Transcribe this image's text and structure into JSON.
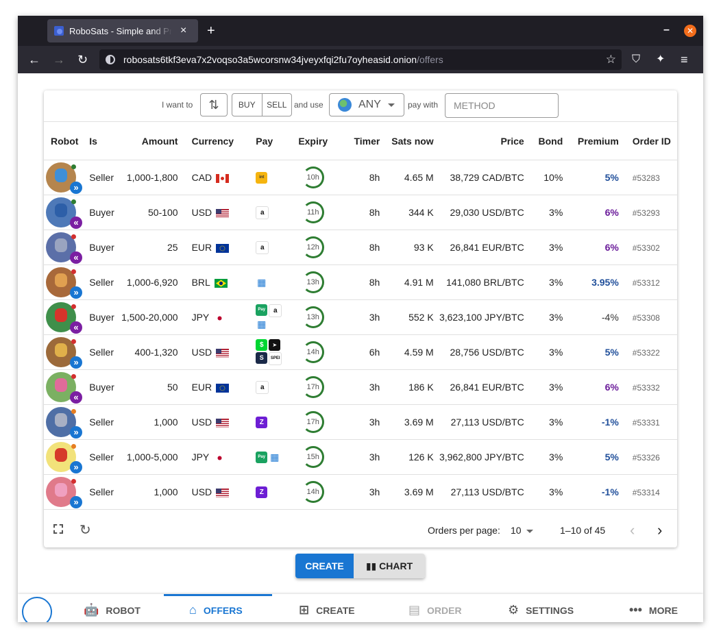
{
  "browser": {
    "tab_title": "RoboSats - Simple and Private",
    "tab_close": "×",
    "new_tab": "+",
    "url_host": "robosats6tkf3eva7x2voqso3a5wcorsnw34jveyxfqi2fu7oyheasid.onion",
    "url_path": "/offers"
  },
  "filters": {
    "i_want_to": "I want to",
    "buy": "BUY",
    "sell": "SELL",
    "and_use": "and use",
    "currency": "ANY",
    "pay_with": "pay with",
    "method_placeholder": "METHOD"
  },
  "table": {
    "headers": [
      "Robot",
      "Is",
      "Amount",
      "Currency",
      "Pay",
      "Expiry",
      "Timer",
      "Sats now",
      "Price",
      "Bond",
      "Premium",
      "Order ID"
    ],
    "rows": [
      {
        "is": "Seller",
        "amount": "1,000-1,800",
        "currency": "CAD",
        "expiry": "10h",
        "timer": "8h",
        "sats": "4.65 M",
        "price": "38,729 CAD/BTC",
        "bond": "10%",
        "premium": "5%",
        "order_id": "#53283"
      },
      {
        "is": "Buyer",
        "amount": "50-100",
        "currency": "USD",
        "expiry": "11h",
        "timer": "8h",
        "sats": "344 K",
        "price": "29,030 USD/BTC",
        "bond": "3%",
        "premium": "6%",
        "order_id": "#53293"
      },
      {
        "is": "Buyer",
        "amount": "25",
        "currency": "EUR",
        "expiry": "12h",
        "timer": "8h",
        "sats": "93 K",
        "price": "26,841 EUR/BTC",
        "bond": "3%",
        "premium": "6%",
        "order_id": "#53302"
      },
      {
        "is": "Seller",
        "amount": "1,000-6,920",
        "currency": "BRL",
        "expiry": "13h",
        "timer": "8h",
        "sats": "4.91 M",
        "price": "141,080 BRL/BTC",
        "bond": "3%",
        "premium": "3.95%",
        "order_id": "#53312"
      },
      {
        "is": "Buyer",
        "amount": "1,500-20,000",
        "currency": "JPY",
        "expiry": "13h",
        "timer": "3h",
        "sats": "552 K",
        "price": "3,623,100 JPY/BTC",
        "bond": "3%",
        "premium": "-4%",
        "order_id": "#53308"
      },
      {
        "is": "Seller",
        "amount": "400-1,320",
        "currency": "USD",
        "expiry": "14h",
        "timer": "6h",
        "sats": "4.59 M",
        "price": "28,756 USD/BTC",
        "bond": "3%",
        "premium": "5%",
        "order_id": "#53322"
      },
      {
        "is": "Buyer",
        "amount": "50",
        "currency": "EUR",
        "expiry": "17h",
        "timer": "3h",
        "sats": "186 K",
        "price": "26,841 EUR/BTC",
        "bond": "3%",
        "premium": "6%",
        "order_id": "#53332"
      },
      {
        "is": "Seller",
        "amount": "1,000",
        "currency": "USD",
        "expiry": "17h",
        "timer": "3h",
        "sats": "3.69 M",
        "price": "27,113 USD/BTC",
        "bond": "3%",
        "premium": "-1%",
        "order_id": "#53331"
      },
      {
        "is": "Seller",
        "amount": "1,000-5,000",
        "currency": "JPY",
        "expiry": "15h",
        "timer": "3h",
        "sats": "126 K",
        "price": "3,962,800 JPY/BTC",
        "bond": "3%",
        "premium": "5%",
        "order_id": "#53326"
      },
      {
        "is": "Seller",
        "amount": "1,000",
        "currency": "USD",
        "expiry": "14h",
        "timer": "3h",
        "sats": "3.69 M",
        "price": "27,113 USD/BTC",
        "bond": "3%",
        "premium": "-1%",
        "order_id": "#53314"
      }
    ]
  },
  "pagination": {
    "orders_per_page_label": "Orders per page:",
    "orders_per_page": "10",
    "range": "1–10 of 45"
  },
  "actions": {
    "create": "CREATE",
    "chart": "CHART"
  },
  "bottom_nav": {
    "robot": "ROBOT",
    "offers": "OFFERS",
    "create": "CREATE",
    "order": "ORDER",
    "settings": "SETTINGS",
    "more": "MORE"
  },
  "colors": {
    "accent": "#1976d2",
    "seller_badge": "#1976d2",
    "buyer_badge": "#7b1fa2",
    "online": "#2e7d32",
    "away": "#e67e22",
    "offline": "#d32f2f"
  }
}
